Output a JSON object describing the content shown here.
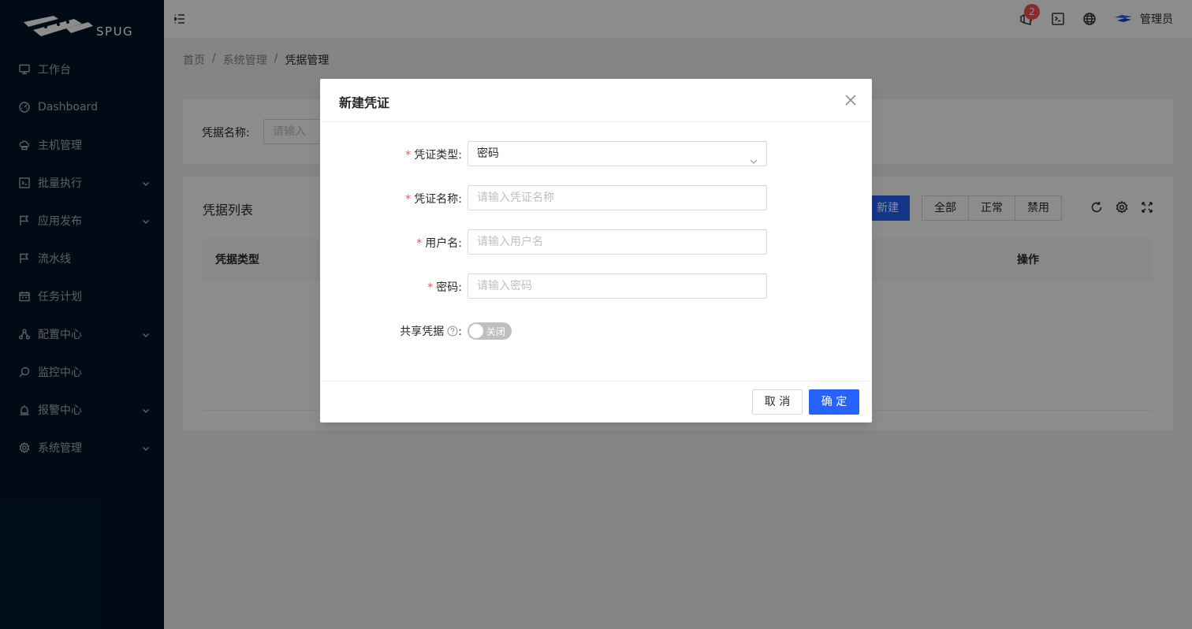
{
  "app": {
    "logo_text": "SPUG"
  },
  "sidebar": {
    "items": [
      {
        "label": "工作台",
        "icon": "desktop-icon",
        "has_children": false
      },
      {
        "label": "Dashboard",
        "icon": "dashboard-icon",
        "has_children": false
      },
      {
        "label": "主机管理",
        "icon": "cloud-server-icon",
        "has_children": false
      },
      {
        "label": "批量执行",
        "icon": "code-icon",
        "has_children": true
      },
      {
        "label": "应用发布",
        "icon": "flag-icon",
        "has_children": true
      },
      {
        "label": "流水线",
        "icon": "flag-icon",
        "has_children": false
      },
      {
        "label": "任务计划",
        "icon": "schedule-icon",
        "has_children": false
      },
      {
        "label": "配置中心",
        "icon": "deployment-icon",
        "has_children": true
      },
      {
        "label": "监控中心",
        "icon": "file-search-icon",
        "has_children": false
      },
      {
        "label": "报警中心",
        "icon": "alert-icon",
        "has_children": true
      },
      {
        "label": "系统管理",
        "icon": "setting-icon",
        "has_children": true
      }
    ]
  },
  "header": {
    "notification_count": "2",
    "user_name": "管理员"
  },
  "breadcrumb": [
    "首页",
    "系统管理",
    "凭据管理"
  ],
  "search": {
    "label": "凭据名称:",
    "placeholder": "请输入"
  },
  "list": {
    "title": "凭据列表",
    "new_label": "新建",
    "filters": [
      "全部",
      "正常",
      "禁用"
    ],
    "columns": [
      "凭据类型",
      "操作"
    ]
  },
  "modal": {
    "title": "新建凭证",
    "fields": {
      "type": {
        "label": "凭证类型",
        "value": "密码"
      },
      "name": {
        "label": "凭证名称",
        "placeholder": "请输入凭证名称"
      },
      "username": {
        "label": "用户名",
        "placeholder": "请输入用户名"
      },
      "password": {
        "label": "密码",
        "placeholder": "请输入密码"
      },
      "shared": {
        "label": "共享凭据",
        "switch_text": "关闭"
      }
    },
    "cancel_label": "取 消",
    "ok_label": "确 定"
  },
  "colors": {
    "primary": "#2563fc",
    "sidebar_bg": "#001529",
    "required": "#ff4d4f",
    "badge": "#ff4d4f"
  }
}
